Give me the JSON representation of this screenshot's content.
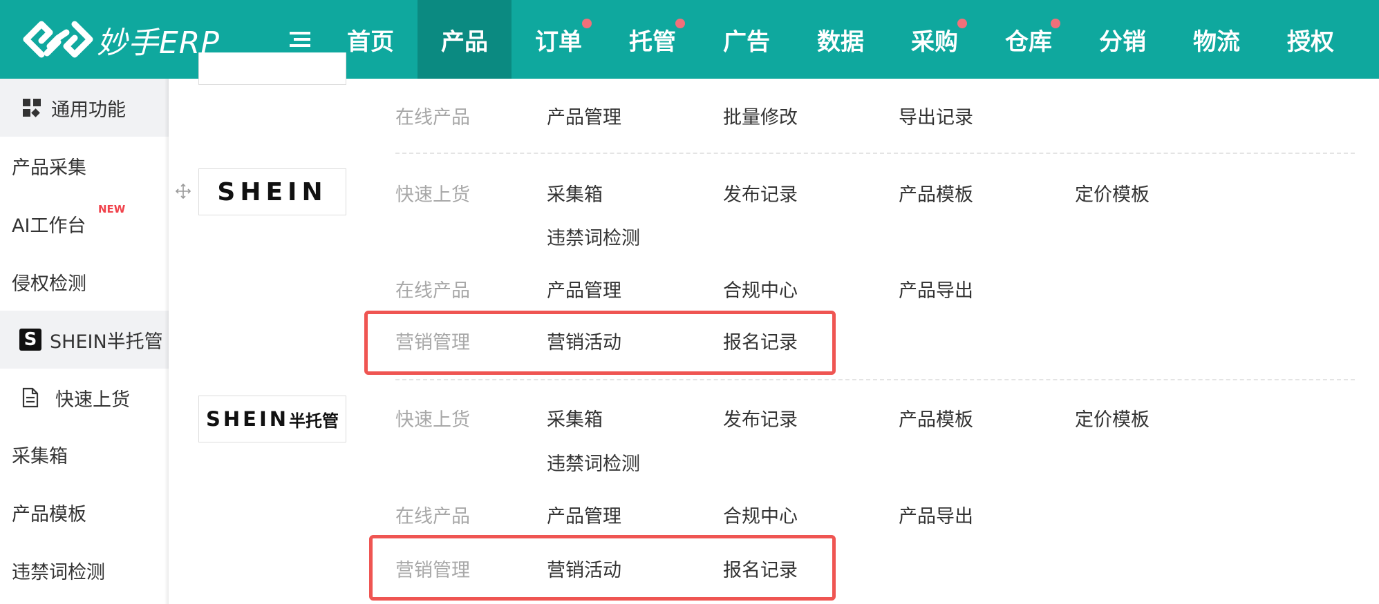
{
  "brand": {
    "name": "妙手ERP"
  },
  "nav": [
    {
      "label": "首页",
      "dot": false,
      "active": false
    },
    {
      "label": "产品",
      "dot": false,
      "active": true
    },
    {
      "label": "订单",
      "dot": true,
      "active": false
    },
    {
      "label": "托管",
      "dot": true,
      "active": false
    },
    {
      "label": "广告",
      "dot": false,
      "active": false
    },
    {
      "label": "数据",
      "dot": false,
      "active": false
    },
    {
      "label": "采购",
      "dot": true,
      "active": false
    },
    {
      "label": "仓库",
      "dot": true,
      "active": false
    },
    {
      "label": "分销",
      "dot": false,
      "active": false
    },
    {
      "label": "物流",
      "dot": false,
      "active": false
    },
    {
      "label": "授权",
      "dot": false,
      "active": false
    }
  ],
  "sidebar": {
    "items": [
      {
        "label": "通用功能",
        "icon": "grid-icon"
      },
      {
        "label": "产品采集"
      },
      {
        "label": "AI工作台",
        "badge": "NEW"
      },
      {
        "label": "侵权检测"
      },
      {
        "label": "SHEIN半托管",
        "icon": "shein-s-icon"
      },
      {
        "label": "快速上货",
        "icon": "document-icon"
      },
      {
        "label": "采集箱"
      },
      {
        "label": "产品模板"
      },
      {
        "label": "违禁词检测"
      }
    ]
  },
  "panel": {
    "top_group": {
      "online_products": {
        "category": "在线产品",
        "links": [
          "产品管理",
          "批量修改",
          "导出记录"
        ]
      }
    },
    "shein": {
      "logo": "SHEIN",
      "quick_listing": {
        "category": "快速上货",
        "links": [
          "采集箱",
          "发布记录",
          "产品模板",
          "定价模板",
          "违禁词检测"
        ]
      },
      "online_products": {
        "category": "在线产品",
        "links": [
          "产品管理",
          "合规中心",
          "产品导出"
        ]
      },
      "marketing": {
        "category": "营销管理",
        "links": [
          "营销活动",
          "报名记录"
        ]
      }
    },
    "shein_semi": {
      "logo": "SHEIN",
      "logo_suffix": "半托管",
      "quick_listing": {
        "category": "快速上货",
        "links": [
          "采集箱",
          "发布记录",
          "产品模板",
          "定价模板",
          "违禁词检测"
        ]
      },
      "online_products": {
        "category": "在线产品",
        "links": [
          "产品管理",
          "合规中心",
          "产品导出"
        ]
      },
      "marketing": {
        "category": "营销管理",
        "links": [
          "营销活动",
          "报名记录"
        ]
      }
    }
  },
  "colors": {
    "topbar": "#0fa89e",
    "topbar_active": "#0b8a81",
    "dot": "#f2707a",
    "highlight": "#ef5552",
    "category_text": "#a8a8a8",
    "new_badge": "#f0424b"
  }
}
